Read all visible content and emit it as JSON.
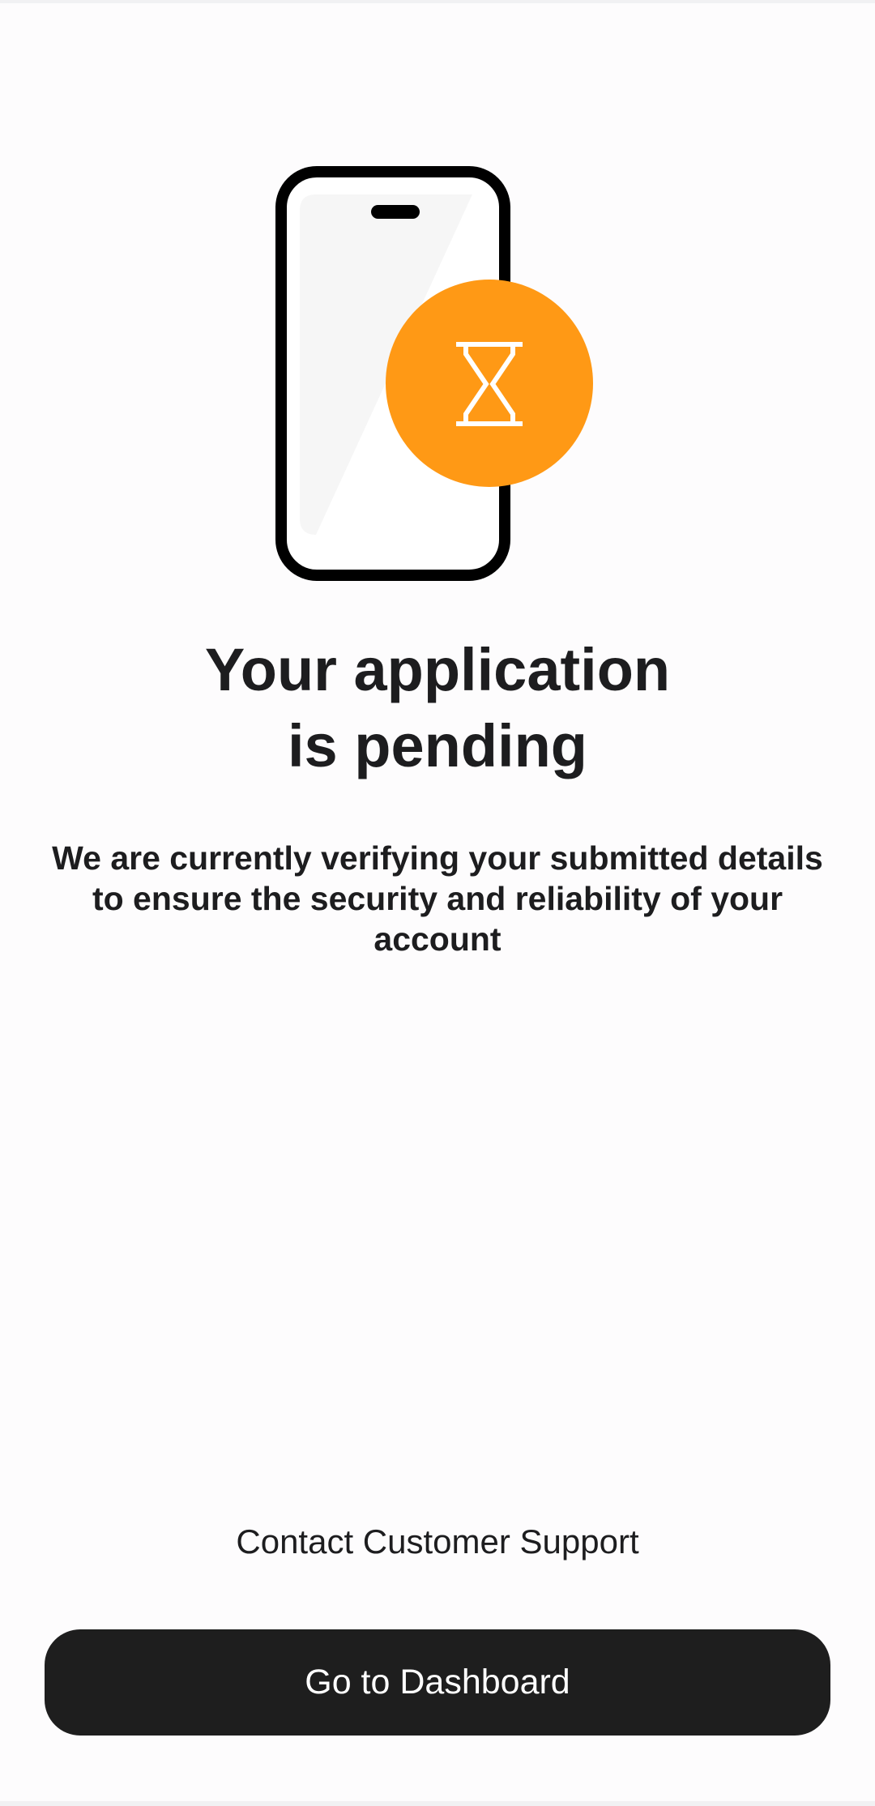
{
  "status": {
    "title_line1": "Your application",
    "title_line2": "is pending",
    "description": "We are currently verifying your submitted details to ensure the security and reliability of your account"
  },
  "illustration": {
    "phone_icon": "smartphone-icon",
    "badge_icon": "hourglass-icon",
    "badge_color": "#FF9915"
  },
  "actions": {
    "support_label": "Contact Customer Support",
    "dashboard_label": "Go to Dashboard"
  }
}
